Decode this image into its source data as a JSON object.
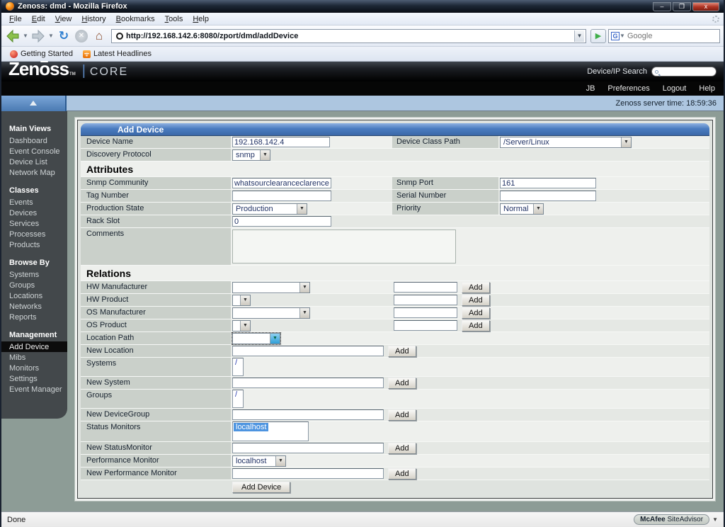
{
  "window": {
    "title": "Zenoss: dmd - Mozilla Firefox",
    "minimize": "–",
    "restore": "❐",
    "close": "x"
  },
  "menu": {
    "items": [
      "File",
      "Edit",
      "View",
      "History",
      "Bookmarks",
      "Tools",
      "Help"
    ]
  },
  "toolbar": {
    "url": "http://192.168.142.6:8080/zport/dmd/addDevice",
    "search_placeholder": "Google",
    "go_glyph": "▶",
    "g_glyph": "G",
    "refresh_glyph": "↻",
    "stop_glyph": "✕",
    "home_glyph": "⌂",
    "caret": "▼"
  },
  "bookmarks": {
    "getting_started": "Getting Started",
    "latest_headlines": "Latest Headlines"
  },
  "header": {
    "logo_zen": "Zen",
    "logo_o": "o",
    "logo_ss": "ss",
    "logo_tm": "TM",
    "logo_sep": "|",
    "logo_core": "CORE",
    "search_label": "Device/IP Search",
    "user": "JB",
    "link_preferences": "Preferences",
    "link_logout": "Logout",
    "link_help": "Help",
    "server_time": "Zenoss server time: 18:59:36"
  },
  "sidebar": {
    "sections": [
      {
        "title": "Main Views",
        "items": [
          "Dashboard",
          "Event Console",
          "Device List",
          "Network Map"
        ]
      },
      {
        "title": "Classes",
        "items": [
          "Events",
          "Devices",
          "Services",
          "Processes",
          "Products"
        ]
      },
      {
        "title": "Browse By",
        "items": [
          "Systems",
          "Groups",
          "Locations",
          "Networks",
          "Reports"
        ]
      },
      {
        "title": "Management",
        "items": [
          "Add Device",
          "Mibs",
          "Monitors",
          "Settings",
          "Event Manager"
        ]
      }
    ],
    "selected_item": "Add Device"
  },
  "form": {
    "title": "Add Device",
    "sections": {
      "attributes": "Attributes",
      "relations": "Relations"
    },
    "device_name": {
      "label": "Device Name",
      "value": "192.168.142.4"
    },
    "device_class_path": {
      "label": "Device Class Path",
      "value": "/Server/Linux"
    },
    "discovery_protocol": {
      "label": "Discovery Protocol",
      "value": "snmp"
    },
    "snmp_community": {
      "label": "Snmp Community",
      "value": "whatsourclearanceclarence"
    },
    "snmp_port": {
      "label": "Snmp Port",
      "value": "161"
    },
    "tag_number": {
      "label": "Tag Number",
      "value": ""
    },
    "serial_number": {
      "label": "Serial Number",
      "value": ""
    },
    "production_state": {
      "label": "Production State",
      "value": "Production"
    },
    "priority": {
      "label": "Priority",
      "value": "Normal"
    },
    "rack_slot": {
      "label": "Rack Slot",
      "value": "0"
    },
    "comments": {
      "label": "Comments",
      "value": ""
    },
    "hw_manufacturer": {
      "label": "HW Manufacturer",
      "value": ""
    },
    "hw_product": {
      "label": "HW Product",
      "value": ""
    },
    "os_manufacturer": {
      "label": "OS Manufacturer",
      "value": ""
    },
    "os_product": {
      "label": "OS Product",
      "value": ""
    },
    "location_path": {
      "label": "Location Path",
      "value": ""
    },
    "new_location": {
      "label": "New Location",
      "value": ""
    },
    "systems": {
      "label": "Systems",
      "option": "/"
    },
    "new_system": {
      "label": "New System",
      "value": ""
    },
    "groups": {
      "label": "Groups",
      "option": "/"
    },
    "new_devicegroup": {
      "label": "New DeviceGroup",
      "value": ""
    },
    "status_monitors": {
      "label": "Status Monitors",
      "selected_option": "localhost"
    },
    "new_statusmonitor": {
      "label": "New StatusMonitor",
      "value": ""
    },
    "performance_monitor": {
      "label": "Performance Monitor",
      "value": "localhost"
    },
    "new_performance_monitor": {
      "label": "New Performance Monitor",
      "value": ""
    },
    "add_label": "Add",
    "submit_label": "Add Device"
  },
  "statusbar": {
    "status": "Done",
    "mcafee_brand": "McAfee",
    "mcafee_product": " SiteAdvisor",
    "caret": "▼"
  },
  "colors": {
    "accent_blue": "#4a7cc0",
    "sidebar_bg": "#43484b",
    "content_bg": "#8d9c96",
    "timebar_bg": "#adc6e0",
    "selection_blue": "#4d94e0"
  }
}
